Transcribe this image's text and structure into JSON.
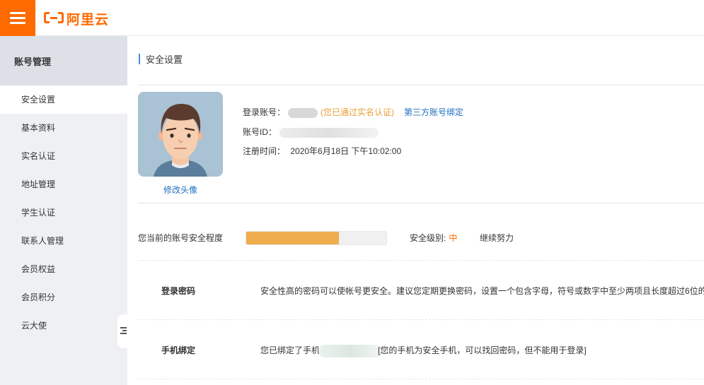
{
  "header": {
    "logo_text": "阿里云",
    "brand_color": "#ff6a00"
  },
  "sidebar": {
    "title": "账号管理",
    "items": [
      {
        "label": "安全设置",
        "active": true
      },
      {
        "label": "基本资料"
      },
      {
        "label": "实名认证"
      },
      {
        "label": "地址管理"
      },
      {
        "label": "学生认证"
      },
      {
        "label": "联系人管理"
      },
      {
        "label": "会员权益"
      },
      {
        "label": "会员积分"
      },
      {
        "label": "云大使"
      }
    ]
  },
  "main": {
    "title": "安全设置",
    "profile": {
      "change_avatar": "修改头像",
      "login_account_label": "登录账号：",
      "verified_text": "(您已通过实名认证)",
      "third_party_link": "第三方账号绑定",
      "account_id_label": "账号ID：",
      "register_label": "注册时间：",
      "register_time": "2020年6月18日 下午10:02:00"
    },
    "security": {
      "label": "您当前的账号安全程度",
      "progress": 0.66,
      "level_label": "安全级别:",
      "level_value": "中",
      "advice": "继续努力"
    },
    "rows": [
      {
        "title": "登录密码",
        "desc": "安全性高的密码可以使帐号更安全。建议您定期更换密码，设置一个包含字母，符号或数字中至少两项且长度超过6位的"
      },
      {
        "title": "手机绑定",
        "desc_prefix": "您已绑定了手机",
        "desc_suffix": "[您的手机为安全手机，可以找回密码，但不能用于登录]"
      }
    ]
  }
}
